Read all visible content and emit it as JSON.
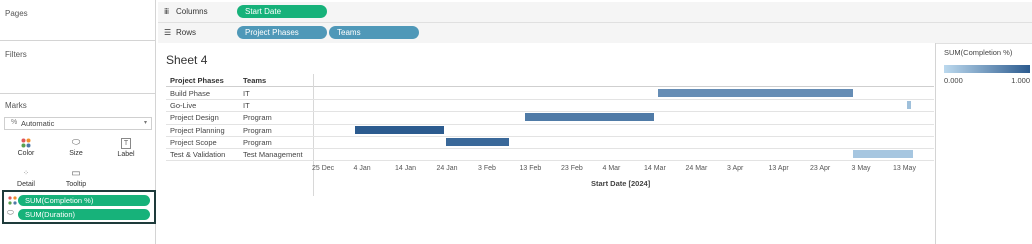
{
  "panes": {
    "pages_title": "Pages",
    "filters_title": "Filters",
    "marks_title": "Marks",
    "marks_type": "Automatic",
    "mark_buttons": [
      "Color",
      "Size",
      "Label",
      "Detail",
      "Tooltip"
    ],
    "mark_pills": [
      "SUM(Completion %)",
      "SUM(Duration)"
    ]
  },
  "shelves": {
    "columns_label": "Columns",
    "columns_pills": [
      "Start Date"
    ],
    "rows_label": "Rows",
    "rows_pills": [
      "Project Phases",
      "Teams"
    ]
  },
  "sheet": {
    "title": "Sheet 4",
    "header_phase": "Project Phases",
    "header_team": "Teams",
    "x_axis_title": "Start Date [2024]"
  },
  "legend": {
    "title": "SUM(Completion %)",
    "min_label": "0.000",
    "max_label": "1.000",
    "color_low": "#bcd9ee",
    "color_high": "#2c5b8f"
  },
  "chart_data": {
    "type": "bar",
    "x_ticks": [
      "25 Dec",
      "4 Jan",
      "14 Jan",
      "24 Jan",
      "3 Feb",
      "13 Feb",
      "23 Feb",
      "4 Mar",
      "14 Mar",
      "24 Mar",
      "3 Apr",
      "13 Apr",
      "23 Apr",
      "3 May",
      "13 May"
    ],
    "xlabel": "Start Date [2024]",
    "rows": [
      {
        "phase": "Build Phase",
        "team": "IT",
        "start_day": 80,
        "end_day": 127,
        "completion": 0.6
      },
      {
        "phase": "Go-Live",
        "team": "IT",
        "start_day": 140,
        "end_day": 141,
        "completion": 0.2
      },
      {
        "phase": "Project Design",
        "team": "Program",
        "start_day": 48,
        "end_day": 79,
        "completion": 0.75
      },
      {
        "phase": "Project Planning",
        "team": "Program",
        "start_day": 7,
        "end_day": 28.5,
        "completion": 1.0
      },
      {
        "phase": "Project Scope",
        "team": "Program",
        "start_day": 29,
        "end_day": 44,
        "completion": 0.9
      },
      {
        "phase": "Test & Validation",
        "team": "Test Management",
        "start_day": 127,
        "end_day": 141.5,
        "completion": 0.15
      }
    ]
  }
}
